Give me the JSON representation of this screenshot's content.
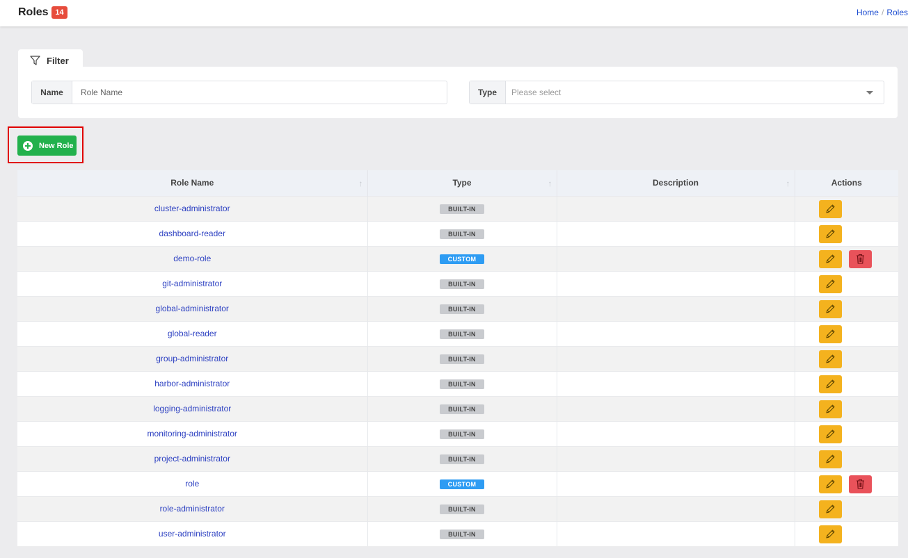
{
  "header": {
    "title": "Roles",
    "count": "14",
    "breadcrumb": {
      "home": "Home",
      "separator": "/",
      "current": "Roles"
    }
  },
  "filter": {
    "tab_label": "Filter",
    "name_label": "Name",
    "name_placeholder": "Role Name",
    "type_label": "Type",
    "type_placeholder": "Please select"
  },
  "toolbar": {
    "new_role_label": "New Role"
  },
  "table": {
    "columns": [
      "Role Name",
      "Type",
      "Description",
      "Actions"
    ],
    "rows": [
      {
        "name": "cluster-administrator",
        "type": "BUILT-IN",
        "description": "",
        "deletable": false
      },
      {
        "name": "dashboard-reader",
        "type": "BUILT-IN",
        "description": "",
        "deletable": false
      },
      {
        "name": "demo-role",
        "type": "CUSTOM",
        "description": "",
        "deletable": true
      },
      {
        "name": "git-administrator",
        "type": "BUILT-IN",
        "description": "",
        "deletable": false
      },
      {
        "name": "global-administrator",
        "type": "BUILT-IN",
        "description": "",
        "deletable": false
      },
      {
        "name": "global-reader",
        "type": "BUILT-IN",
        "description": "",
        "deletable": false
      },
      {
        "name": "group-administrator",
        "type": "BUILT-IN",
        "description": "",
        "deletable": false
      },
      {
        "name": "harbor-administrator",
        "type": "BUILT-IN",
        "description": "",
        "deletable": false
      },
      {
        "name": "logging-administrator",
        "type": "BUILT-IN",
        "description": "",
        "deletable": false
      },
      {
        "name": "monitoring-administrator",
        "type": "BUILT-IN",
        "description": "",
        "deletable": false
      },
      {
        "name": "project-administrator",
        "type": "BUILT-IN",
        "description": "",
        "deletable": false
      },
      {
        "name": "role",
        "type": "CUSTOM",
        "description": "",
        "deletable": true
      },
      {
        "name": "role-administrator",
        "type": "BUILT-IN",
        "description": "",
        "deletable": false
      },
      {
        "name": "user-administrator",
        "type": "BUILT-IN",
        "description": "",
        "deletable": false
      }
    ]
  },
  "colors": {
    "new_role_green": "#22b14c",
    "edit_yellow": "#f4b21e",
    "delete_red": "#e9525a",
    "custom_blue": "#2e9cf3",
    "builtin_gray": "#c9cbcf",
    "link_blue": "#2b3fc1",
    "badge_red": "#e74c3c",
    "highlight_red": "#e00000"
  },
  "icons": {
    "filter": "filter-funnel-icon",
    "add": "plus-circle-icon",
    "edit": "pencil-icon",
    "delete": "trash-icon",
    "sort": "sort-arrow-icon",
    "dropdown": "caret-down-icon"
  }
}
